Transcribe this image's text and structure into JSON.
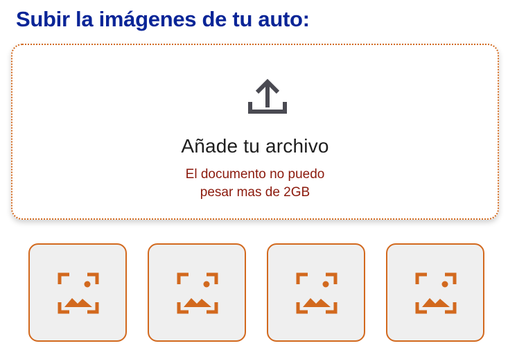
{
  "header": {
    "title": "Subir la imágenes de tu auto:"
  },
  "dropzone": {
    "icon": "upload-icon",
    "label": "Añade tu archivo",
    "note_line1": "El documento no puedo",
    "note_line2": "pesar mas de 2GB"
  },
  "image_slots": [
    {
      "icon": "image-placeholder-icon"
    },
    {
      "icon": "image-placeholder-icon"
    },
    {
      "icon": "image-placeholder-icon"
    },
    {
      "icon": "image-placeholder-icon"
    }
  ],
  "colors": {
    "title": "#0a2597",
    "accent": "#d2691e",
    "note": "#8b1a0d",
    "slot_bg": "#efefef"
  }
}
